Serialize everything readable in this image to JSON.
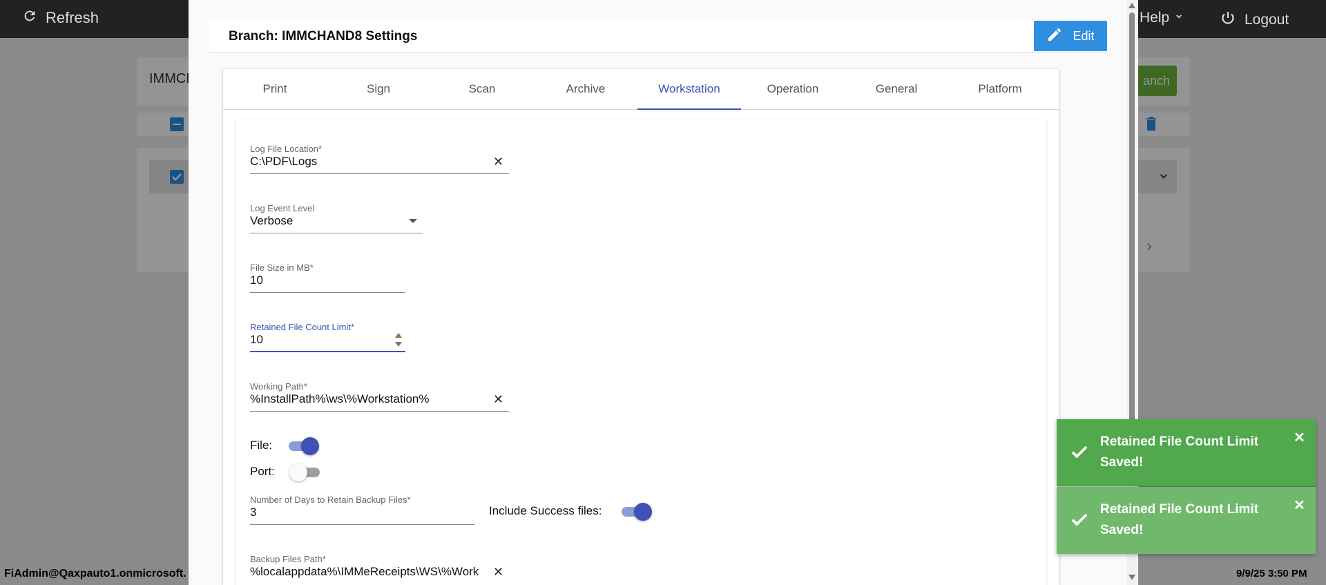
{
  "topbar": {
    "refresh_label": "Refresh",
    "help_label": "Help",
    "logout_label": "Logout"
  },
  "background": {
    "search_value": "IMMCH",
    "branch_button_label": "anch"
  },
  "footer": {
    "user": "FiAdmin@Qaxpauto1.onmicrosoft.",
    "datetime": "9/9/25 3:50 PM"
  },
  "modal": {
    "title": "Branch: IMMCHAND8 Settings",
    "edit_label": "Edit",
    "tabs": [
      "Print",
      "Sign",
      "Scan",
      "Archive",
      "Workstation",
      "Operation",
      "General",
      "Platform"
    ],
    "active_tab": "Workstation",
    "fields": {
      "log_file_location": {
        "label": "Log File Location*",
        "value": "C:\\PDF\\Logs"
      },
      "log_event_level": {
        "label": "Log Event Level",
        "value": "Verbose"
      },
      "file_size": {
        "label": "File Size in MB*",
        "value": "10"
      },
      "retained_count": {
        "label": "Retained File Count Limit*",
        "value": "10"
      },
      "working_path": {
        "label": "Working Path*",
        "value": "%InstallPath%\\ws\\%Workstation%"
      },
      "file_toggle": {
        "label": "File:",
        "on": true
      },
      "port_toggle": {
        "label": "Port:",
        "on": false
      },
      "retain_days": {
        "label": "Number of Days to Retain Backup Files*",
        "value": "3"
      },
      "include_success": {
        "label": "Include Success files:",
        "on": true
      },
      "backup_path": {
        "label": "Backup Files Path*",
        "value": "%localappdata%\\IMMeReceipts\\WS\\%Work"
      }
    }
  },
  "toasts": [
    {
      "message": "Retained File Count Limit Saved!"
    },
    {
      "message": "Retained File Count Limit Saved!"
    }
  ],
  "colors": {
    "accent": "#3f51b5",
    "edit_button": "#2f8ee0",
    "toast": "#52a84c",
    "topbar": "#222222"
  }
}
